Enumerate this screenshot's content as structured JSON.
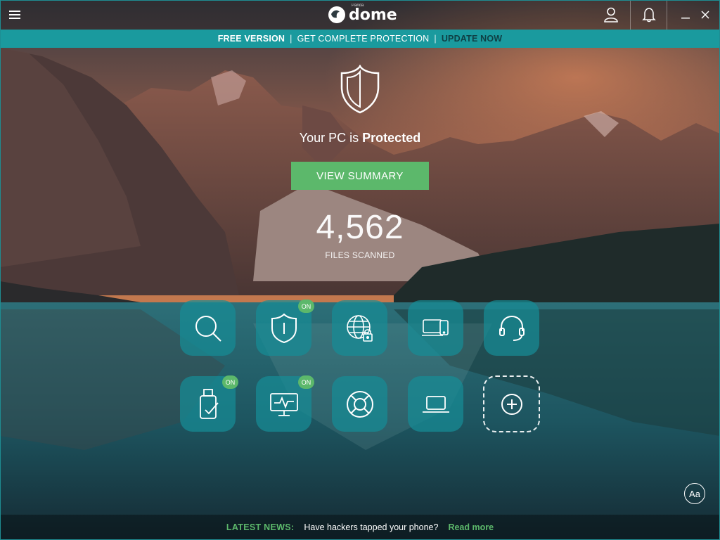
{
  "app": {
    "brand_name": "dome",
    "brand_small": "Panda",
    "menu_icon": "hamburger-menu-icon",
    "user_icon": "user-icon",
    "notifications_icon": "bell-icon",
    "minimize_icon": "minimize-icon",
    "close_icon": "close-icon"
  },
  "promo": {
    "free_version": "FREE VERSION",
    "separator": "|",
    "get_protection": "GET COMPLETE PROTECTION",
    "update_now": "UPDATE NOW"
  },
  "status": {
    "prefix": "Your PC is",
    "state": "Protected",
    "summary_button": "VIEW SUMMARY",
    "files_scanned_count": "4,562",
    "files_scanned_label": "FILES SCANNED"
  },
  "modules": [
    {
      "name": "scan",
      "icon": "magnifier-icon",
      "badge": ""
    },
    {
      "name": "antivirus",
      "icon": "shield-icon",
      "badge": "ON"
    },
    {
      "name": "web-protection",
      "icon": "globe-lock-icon",
      "badge": ""
    },
    {
      "name": "devices",
      "icon": "devices-icon",
      "badge": ""
    },
    {
      "name": "support",
      "icon": "headset-icon",
      "badge": ""
    },
    {
      "name": "usb-protection",
      "icon": "usb-check-icon",
      "badge": "ON"
    },
    {
      "name": "process-monitor",
      "icon": "monitor-pulse-icon",
      "badge": "ON"
    },
    {
      "name": "rescue-kit",
      "icon": "lifebuoy-icon",
      "badge": ""
    },
    {
      "name": "my-products",
      "icon": "laptop-icon",
      "badge": ""
    },
    {
      "name": "add-module",
      "icon": "plus-circle-icon",
      "badge": ""
    }
  ],
  "news": {
    "label": "LATEST NEWS:",
    "headline": "Have hackers tapped your phone?",
    "read_more": "Read more"
  },
  "font_button": "Aa",
  "colors": {
    "accent_teal": "#1a9a9e",
    "accent_green": "#5cb86b",
    "promo_dark_text": "#0f3f44",
    "tile_bg": "#168c96"
  }
}
